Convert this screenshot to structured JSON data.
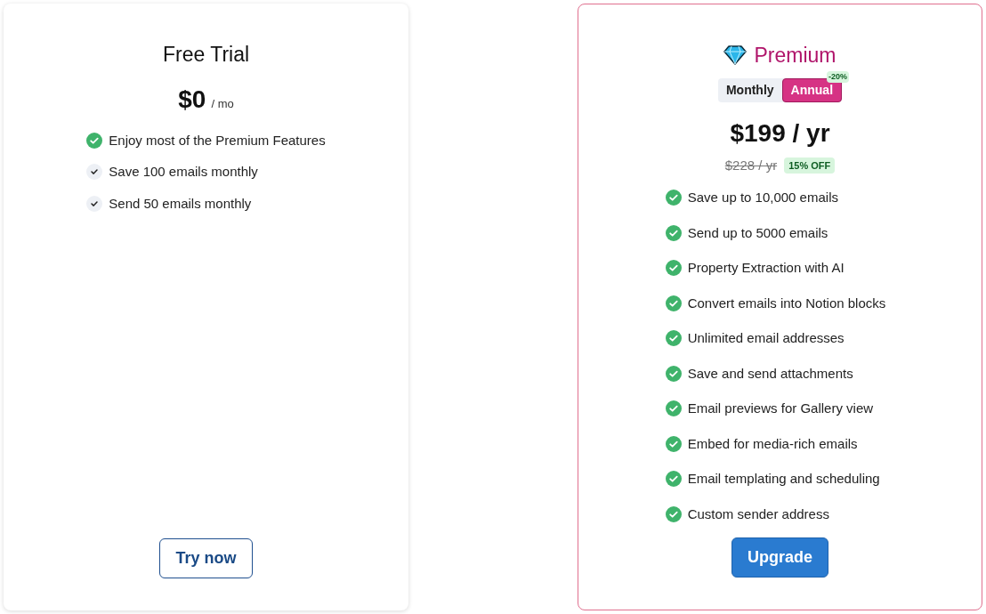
{
  "plans": [
    {
      "title": "Free Trial",
      "featured": false,
      "price": "$0",
      "period": "/ mo",
      "features": [
        {
          "text": "Enjoy most of the Premium Features",
          "kind": "highlight"
        },
        {
          "text": "Save 100 emails monthly",
          "kind": "plain"
        },
        {
          "text": "Send 50 emails monthly",
          "kind": "plain"
        }
      ],
      "button": {
        "label": "Try now",
        "kind": "outline"
      }
    },
    {
      "title": "Premium",
      "featured": true,
      "billing": [
        {
          "label": "Monthly",
          "selected": false
        },
        {
          "label": "Annual",
          "selected": true,
          "badge": "-20%"
        }
      ],
      "price": "$199 / yr",
      "old_price": "$228 / yr",
      "discount": "15% OFF",
      "features": [
        {
          "text": "Save up to 10,000 emails",
          "kind": "highlight"
        },
        {
          "text": "Send up to 5000 emails",
          "kind": "highlight"
        },
        {
          "text": "Property Extraction with AI",
          "kind": "highlight"
        },
        {
          "text": "Convert emails into Notion blocks",
          "kind": "highlight"
        },
        {
          "text": "Unlimited email addresses",
          "kind": "highlight"
        },
        {
          "text": "Save and send attachments",
          "kind": "highlight"
        },
        {
          "text": "Email previews for Gallery view",
          "kind": "highlight"
        },
        {
          "text": "Embed for media-rich emails",
          "kind": "highlight"
        },
        {
          "text": "Email templating and scheduling",
          "kind": "highlight"
        },
        {
          "text": "Custom sender address",
          "kind": "highlight"
        }
      ],
      "button": {
        "label": "Upgrade",
        "kind": "solid"
      }
    }
  ]
}
